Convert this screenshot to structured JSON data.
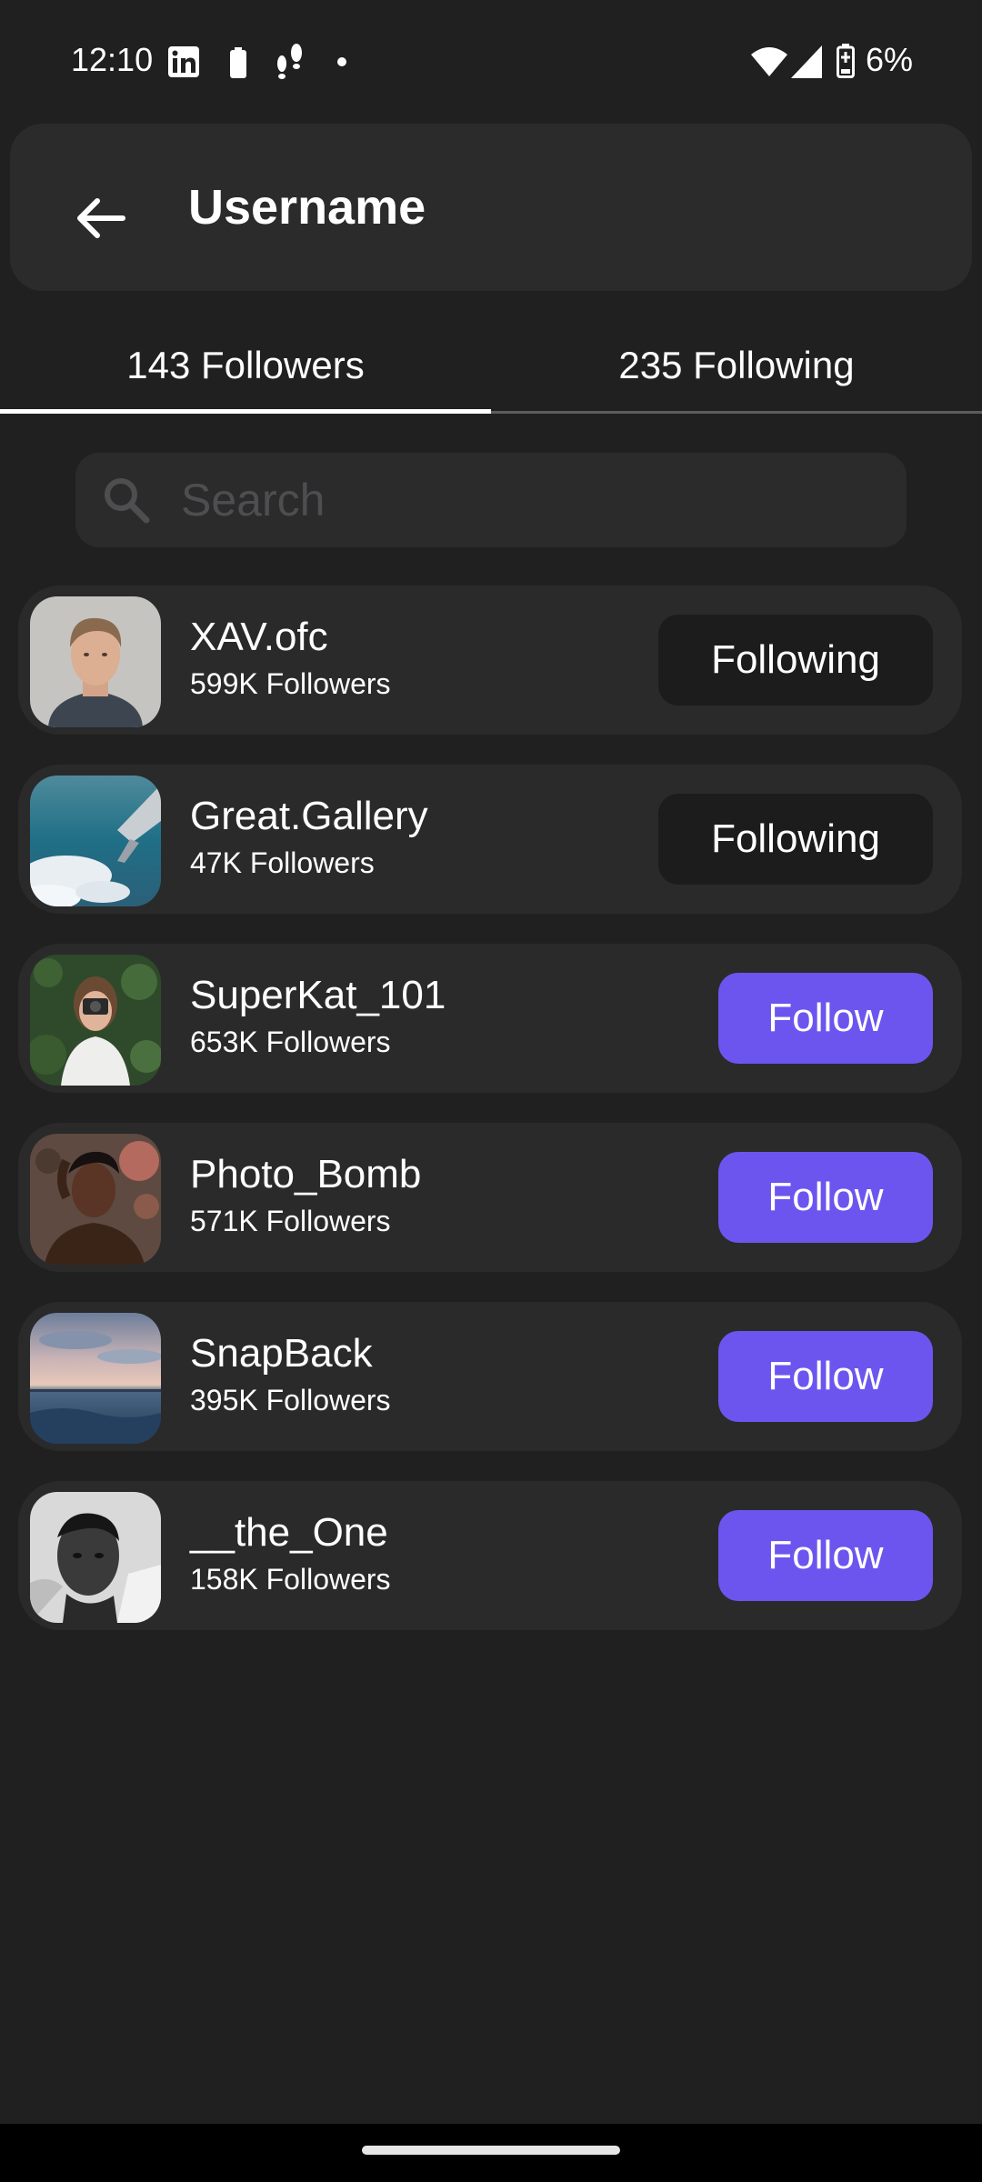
{
  "status_bar": {
    "time": "12:10",
    "battery_percent": "6%",
    "icons": [
      "linkedin-icon",
      "battery-small-icon",
      "steps-icon",
      "dot-icon",
      "wifi-icon",
      "signal-icon",
      "battery-icon"
    ]
  },
  "app_bar": {
    "back_icon": "arrow-left-icon",
    "title": "Username"
  },
  "tabs": [
    {
      "label": "143 Followers",
      "selected": true
    },
    {
      "label": "235 Following",
      "selected": false
    }
  ],
  "search": {
    "placeholder": "Search",
    "value": ""
  },
  "users": [
    {
      "name": "XAV.ofc",
      "followers": "599K Followers",
      "button": "Following",
      "following": true
    },
    {
      "name": "Great.Gallery",
      "followers": "47K Followers",
      "button": "Following",
      "following": true
    },
    {
      "name": "SuperKat_101",
      "followers": "653K Followers",
      "button": "Follow",
      "following": false
    },
    {
      "name": "Photo_Bomb",
      "followers": "571K Followers",
      "button": "Follow",
      "following": false
    },
    {
      "name": "SnapBack",
      "followers": "395K Followers",
      "button": "Follow",
      "following": false
    },
    {
      "name": "__the_One",
      "followers": "158K Followers",
      "button": "Follow",
      "following": false
    }
  ],
  "colors": {
    "background": "#202021",
    "card": "#2a2a2b",
    "accent": "#6c55ef",
    "following_button": "#1c1c1d"
  }
}
